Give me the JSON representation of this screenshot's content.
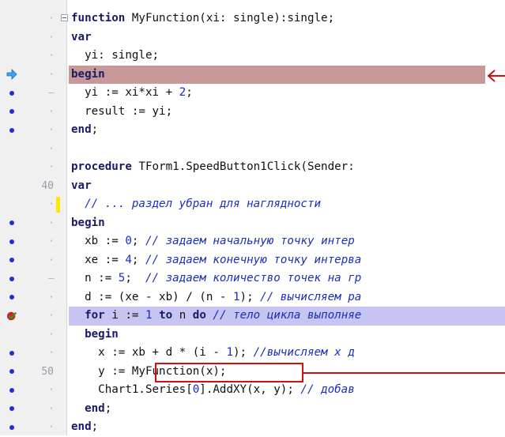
{
  "editor": {
    "lines": [
      {
        "gutter_mark": "·",
        "line_number": "",
        "fold": true,
        "segments": [
          {
            "t": "function",
            "c": "kw"
          },
          {
            "t": " MyFunction(xi: single):single;",
            "c": ""
          }
        ]
      },
      {
        "gutter_mark": "·",
        "line_number": "",
        "segments": [
          {
            "t": "var",
            "c": "kw"
          }
        ]
      },
      {
        "gutter_mark": "·",
        "line_number": "",
        "segments": [
          {
            "t": "  yi: single;",
            "c": ""
          }
        ]
      },
      {
        "gutter_mark": "·",
        "line_number": "",
        "breakpoint": "exec-arrow",
        "highlight": "red",
        "segments": [
          {
            "t": "begin",
            "c": "kw"
          }
        ]
      },
      {
        "gutter_mark": "–",
        "line_number": "",
        "breakpoint": "dot",
        "segments": [
          {
            "t": "  yi := xi*xi + ",
            "c": ""
          },
          {
            "t": "2",
            "c": "num"
          },
          {
            "t": ";",
            "c": ""
          }
        ]
      },
      {
        "gutter_mark": "·",
        "line_number": "",
        "breakpoint": "dot",
        "segments": [
          {
            "t": "  result := yi;",
            "c": ""
          }
        ]
      },
      {
        "gutter_mark": "·",
        "line_number": "",
        "breakpoint": "dot",
        "segments": [
          {
            "t": "end",
            "c": "kw"
          },
          {
            "t": ";",
            "c": ""
          }
        ]
      },
      {
        "gutter_mark": "·",
        "line_number": "",
        "segments": []
      },
      {
        "gutter_mark": "·",
        "line_number": "",
        "segments": [
          {
            "t": "procedure",
            "c": "kw"
          },
          {
            "t": " TForm1.SpeedButton1Click(Sender:",
            "c": ""
          }
        ]
      },
      {
        "gutter_mark": "",
        "line_number": "40",
        "segments": [
          {
            "t": "var",
            "c": "kw"
          }
        ]
      },
      {
        "gutter_mark": "·",
        "line_number": "",
        "modified": true,
        "segments": [
          {
            "t": "  // ... раздел убран для наглядности",
            "c": "cm"
          }
        ]
      },
      {
        "gutter_mark": "·",
        "line_number": "",
        "breakpoint": "dot",
        "segments": [
          {
            "t": "begin",
            "c": "kw"
          }
        ]
      },
      {
        "gutter_mark": "·",
        "line_number": "",
        "breakpoint": "dot",
        "segments": [
          {
            "t": "  xb := ",
            "c": ""
          },
          {
            "t": "0",
            "c": "num"
          },
          {
            "t": "; ",
            "c": ""
          },
          {
            "t": "// задаем начальную точку интер",
            "c": "cm"
          }
        ]
      },
      {
        "gutter_mark": "·",
        "line_number": "",
        "breakpoint": "dot",
        "segments": [
          {
            "t": "  xe := ",
            "c": ""
          },
          {
            "t": "4",
            "c": "num"
          },
          {
            "t": "; ",
            "c": ""
          },
          {
            "t": "// задаем конечную точку интерва",
            "c": "cm"
          }
        ]
      },
      {
        "gutter_mark": "–",
        "line_number": "",
        "breakpoint": "dot",
        "segments": [
          {
            "t": "  n := ",
            "c": ""
          },
          {
            "t": "5",
            "c": "num"
          },
          {
            "t": ";  ",
            "c": ""
          },
          {
            "t": "// задаем количество точек на гр",
            "c": "cm"
          }
        ]
      },
      {
        "gutter_mark": "·",
        "line_number": "",
        "breakpoint": "dot",
        "segments": [
          {
            "t": "  d := (xe - xb) / (n - ",
            "c": ""
          },
          {
            "t": "1",
            "c": "num"
          },
          {
            "t": "); ",
            "c": ""
          },
          {
            "t": "// вычисляем ра",
            "c": "cm"
          }
        ]
      },
      {
        "gutter_mark": "·",
        "line_number": "",
        "breakpoint": "bp-check",
        "highlight": "blue",
        "segments": [
          {
            "t": "  ",
            "c": ""
          },
          {
            "t": "for",
            "c": "kw"
          },
          {
            "t": " i := ",
            "c": ""
          },
          {
            "t": "1",
            "c": "num"
          },
          {
            "t": " ",
            "c": ""
          },
          {
            "t": "to",
            "c": "kw"
          },
          {
            "t": " n ",
            "c": ""
          },
          {
            "t": "do",
            "c": "kw"
          },
          {
            "t": " ",
            "c": ""
          },
          {
            "t": "// тело цикла выполняе",
            "c": "cm"
          }
        ]
      },
      {
        "gutter_mark": "·",
        "line_number": "",
        "segments": [
          {
            "t": "  ",
            "c": ""
          },
          {
            "t": "begin",
            "c": "kw"
          }
        ]
      },
      {
        "gutter_mark": "·",
        "line_number": "",
        "breakpoint": "dot",
        "segments": [
          {
            "t": "    x := xb + d * (i - ",
            "c": ""
          },
          {
            "t": "1",
            "c": "num"
          },
          {
            "t": "); ",
            "c": ""
          },
          {
            "t": "//вычисляем х д",
            "c": "cm"
          }
        ]
      },
      {
        "gutter_mark": "",
        "line_number": "50",
        "breakpoint": "dot",
        "segments": [
          {
            "t": "    y := MyFunction(x);",
            "c": ""
          }
        ]
      },
      {
        "gutter_mark": "·",
        "line_number": "",
        "breakpoint": "dot",
        "segments": [
          {
            "t": "    Chart1.Series[",
            "c": ""
          },
          {
            "t": "0",
            "c": "num"
          },
          {
            "t": "].AddXY(x, y); ",
            "c": ""
          },
          {
            "t": "// добав",
            "c": "cm"
          }
        ]
      },
      {
        "gutter_mark": "·",
        "line_number": "",
        "breakpoint": "dot",
        "segments": [
          {
            "t": "  ",
            "c": ""
          },
          {
            "t": "end",
            "c": "kw"
          },
          {
            "t": ";",
            "c": ""
          }
        ]
      },
      {
        "gutter_mark": "·",
        "line_number": "",
        "breakpoint": "dot",
        "segments": [
          {
            "t": "end",
            "c": "kw"
          },
          {
            "t": ";",
            "c": ""
          }
        ]
      }
    ]
  },
  "colors": {
    "keyword": "#1a1a66",
    "number": "#1a25d8",
    "comment": "#1a2fb8",
    "exec_line": "#c99898",
    "breakpoint_line": "#c6c4f0",
    "annotation": "#d21010"
  },
  "icons": {
    "exec_point": "exec-point-arrow-icon",
    "breakpoint_dot": "breakpoint-dot-icon",
    "breakpoint_valid": "breakpoint-valid-icon",
    "annotation_arrow": "annotation-arrow-icon"
  }
}
